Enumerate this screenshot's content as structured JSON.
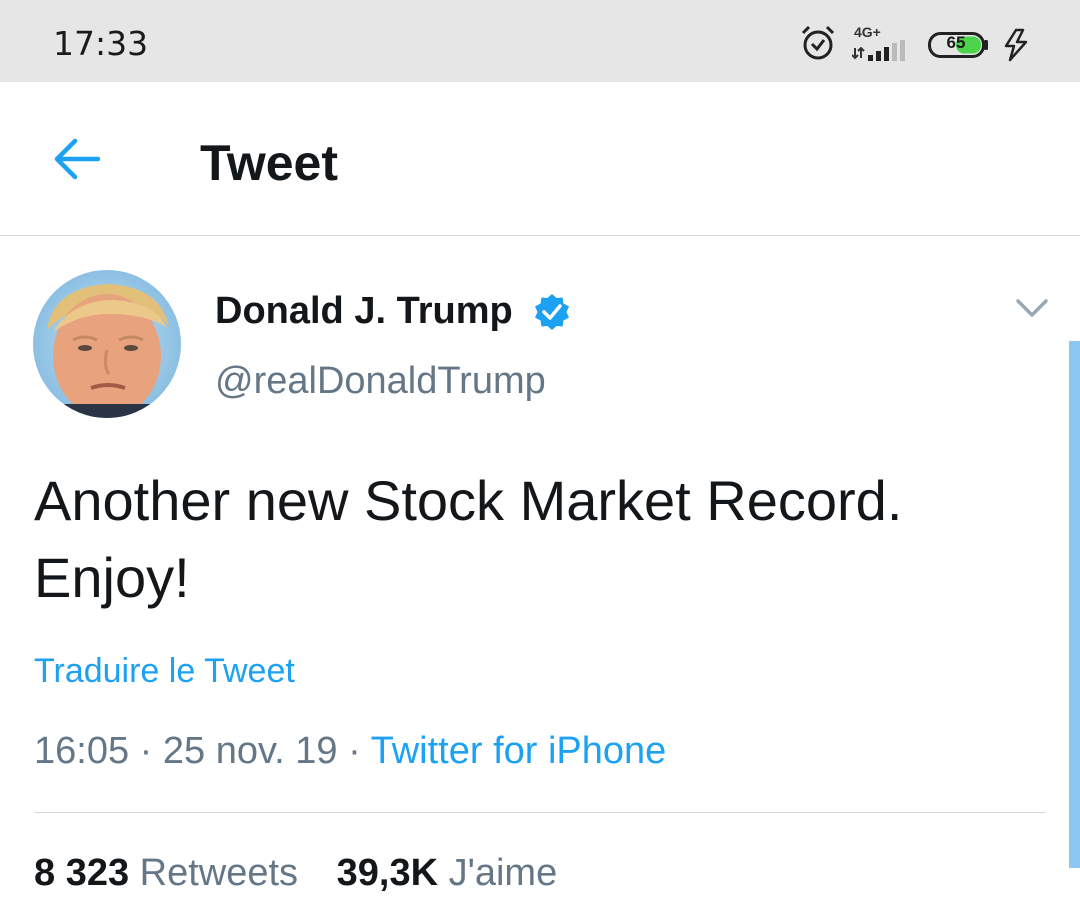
{
  "status_bar": {
    "time": "17:33",
    "network": "4G+",
    "battery": "65",
    "icons": [
      "alarm-icon",
      "signal-icon",
      "battery-icon",
      "charging-icon"
    ]
  },
  "header": {
    "title": "Tweet",
    "back_icon": "back-arrow-icon"
  },
  "tweet": {
    "author_name": "Donald J. Trump",
    "handle": "@realDonaldTrump",
    "verified": true,
    "text_line1": "Another new Stock Market Record.",
    "text_line2": "Enjoy!",
    "translate_label": "Traduire le Tweet",
    "time": "16:05",
    "date": "25 nov. 19",
    "separator": "·",
    "source": "Twitter for iPhone"
  },
  "stats": {
    "retweets_count": "8 323",
    "retweets_label": "Retweets",
    "likes_count": "39,3K",
    "likes_label": "J'aime"
  },
  "colors": {
    "accent": "#1da1f2",
    "muted": "#657786",
    "text": "#14171a",
    "status_bar_bg": "#e6e6e6"
  }
}
